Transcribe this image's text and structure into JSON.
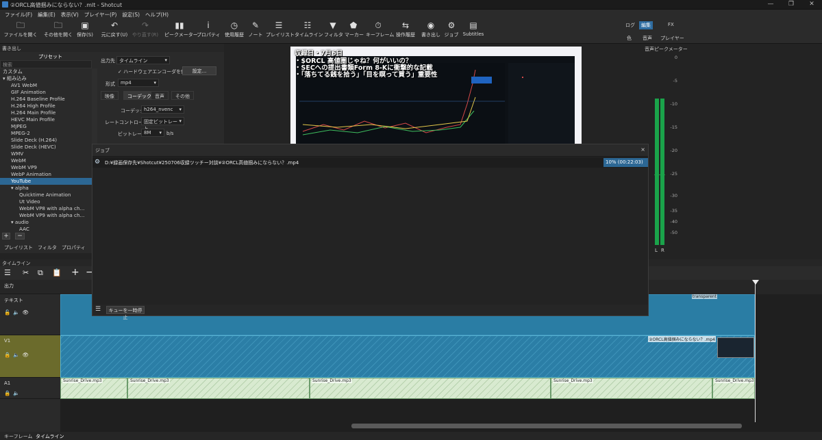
{
  "window": {
    "title": "②ORCL高値掴みにならない？.mlt - Shotcut"
  },
  "menu": [
    "ファイル(F)",
    "編集(E)",
    "表示(V)",
    "プレイヤー(P)",
    "設定(S)",
    "ヘルプ(H)"
  ],
  "toolbar": {
    "open": "ファイルを開く",
    "open_other": "その他を開く",
    "save": "保存(S)",
    "undo": "元に戻す(U)",
    "redo": "やり直す(R)",
    "peak_meter": "ピークメーター",
    "properties": "プロパティ",
    "history": "使用履歴",
    "notes": "ノート",
    "playlist": "プレイリスト",
    "timeline": "タイムライン",
    "filters": "フィルタ",
    "markers": "マーカー",
    "keyframes": "キーフレーム",
    "op_history": "操作履歴",
    "export": "書き出し",
    "jobs": "ジョブ",
    "subtitles": "Subtitles"
  },
  "layouts": {
    "log": "ログ",
    "edit": "編集",
    "fx": "FX",
    "color": "色",
    "audio": "音声",
    "player": "プレイヤー"
  },
  "export_panel": {
    "title": "書き出し",
    "presets_tab": "プリセット",
    "search_placeholder": "検索",
    "from_label": "出力先",
    "from_value": "タイムライン",
    "hw_encoder": "ハードウェアエンコーダを使用",
    "settings_btn": "設定...",
    "format_label": "形式",
    "format_value": "mp4",
    "tabs": [
      "映像",
      "コーデック",
      "音声",
      "その他"
    ],
    "codec_label": "コーデック",
    "codec_value": "h264_nvenc",
    "rate_control_label": "レートコントロール",
    "rate_control_value": "固定ビットレート",
    "bitrate_label": "ビットレート",
    "bitrate_value": "8M",
    "bitrate_unit": "b/s",
    "preset_list": [
      {
        "label": "カスタム",
        "indent": 0
      },
      {
        "label": "▾ 組み込み",
        "indent": 0
      },
      {
        "label": "AV1 WebM",
        "indent": 1
      },
      {
        "label": "GIF Animation",
        "indent": 1
      },
      {
        "label": "H.264 Baseline Profile",
        "indent": 1
      },
      {
        "label": "H.264 High Profile",
        "indent": 1
      },
      {
        "label": "H.264 Main Profile",
        "indent": 1
      },
      {
        "label": "HEVC Main Profile",
        "indent": 1
      },
      {
        "label": "MJPEG",
        "indent": 1
      },
      {
        "label": "MPEG-2",
        "indent": 1
      },
      {
        "label": "Slide Deck (H.264)",
        "indent": 1
      },
      {
        "label": "Slide Deck (HEVC)",
        "indent": 1
      },
      {
        "label": "WMV",
        "indent": 1
      },
      {
        "label": "WebM",
        "indent": 1
      },
      {
        "label": "WebM VP9",
        "indent": 1
      },
      {
        "label": "WebP Animation",
        "indent": 1
      },
      {
        "label": "YouTube",
        "indent": 1,
        "selected": true
      },
      {
        "label": "▾ alpha",
        "indent": 1
      },
      {
        "label": "Quicktime Animation",
        "indent": 2
      },
      {
        "label": "Ut Video",
        "indent": 2
      },
      {
        "label": "WebM VP8 with alpha ch...",
        "indent": 2
      },
      {
        "label": "WebM VP9 with alpha ch...",
        "indent": 2
      },
      {
        "label": "▾ audio",
        "indent": 1
      },
      {
        "label": "AAC",
        "indent": 2
      }
    ],
    "bottom_tabs": [
      "プレイリスト",
      "フィルタ",
      "プロパティ"
    ]
  },
  "preview": {
    "line1": "収録日・7月6日",
    "line2": "・$ORCL 高値圏じゃね？何がいいの？",
    "line3": "・SECへの提出書類Form 8-Kに衝撃的な記載",
    "line4": "・「落ちてる銭を拾う」「目を瞑って買う」重要性"
  },
  "audio_meter": {
    "title": "音声ピークメーター",
    "ticks": [
      "0",
      "-5",
      "-10",
      "-15",
      "-20",
      "-25",
      "-30",
      "-35",
      "-40",
      "-50"
    ],
    "channels": [
      "L",
      "R"
    ],
    "levels": [
      0.78,
      0.78
    ]
  },
  "jobs": {
    "title": "ジョブ",
    "job_path": "D:¥録画保存先¥Shotcut¥250706収録ツッチー対談¥②ORCL高値掴みにならない？.mp4",
    "progress_text": "10% (00:22:03)",
    "progress": 0.1,
    "pause_btn": "キューを一時停止"
  },
  "timeline": {
    "title": "タイムライン",
    "output_label": "出力",
    "tracks": [
      "テキスト",
      "V1",
      "A1"
    ],
    "text_clip_label": "transparent",
    "video_clip_label": "②ORCL高値掴みにならない？.mp4",
    "audio_clip_label": "Sunrise_Drive.mp3",
    "bottom_tabs": [
      "キーフレーム",
      "タイムライン"
    ]
  },
  "colors": {
    "accent": "#2c6794",
    "clip_blue": "#2a7da4",
    "audio_clip": "#d8ead0",
    "meter_green": "#1aa34a"
  }
}
